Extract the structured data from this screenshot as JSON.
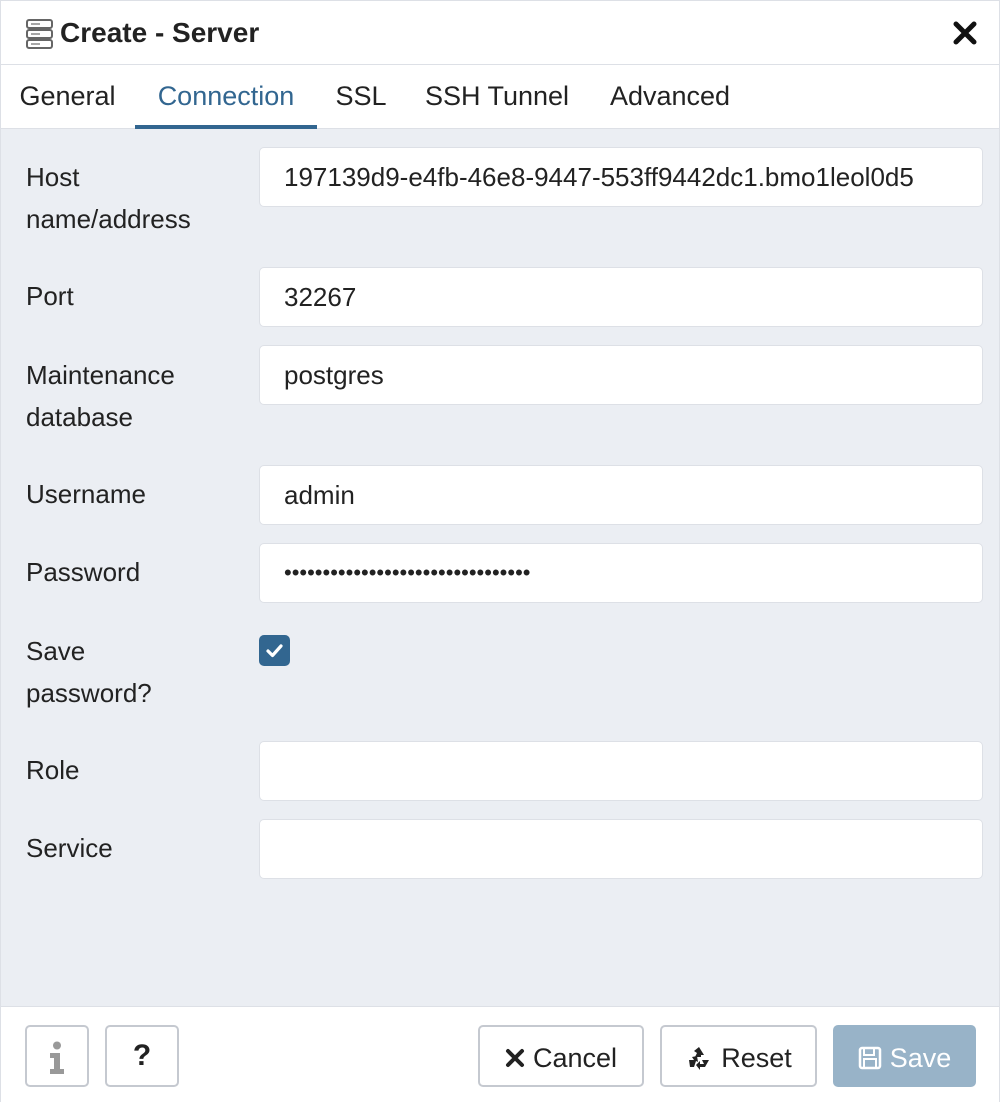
{
  "dialog": {
    "title": "Create - Server"
  },
  "tabs": [
    {
      "label": "General"
    },
    {
      "label": "Connection"
    },
    {
      "label": "SSL"
    },
    {
      "label": "SSH Tunnel"
    },
    {
      "label": "Advanced"
    }
  ],
  "active_tab": "Connection",
  "form": {
    "host": {
      "label_line1": "Host",
      "label_line2": "name/address",
      "value": "197139d9-e4fb-46e8-9447-553ff9442dc1.bmo1leol0d5"
    },
    "port": {
      "label": "Port",
      "value": "32267"
    },
    "maintenance_db": {
      "label_line1": "Maintenance",
      "label_line2": "database",
      "value": "postgres"
    },
    "username": {
      "label": "Username",
      "value": "admin"
    },
    "password": {
      "label": "Password",
      "value": "••••••••••••••••••••••••••••••••"
    },
    "save_password": {
      "label_line1": "Save",
      "label_line2": "password?",
      "checked": true
    },
    "role": {
      "label": "Role",
      "value": ""
    },
    "service": {
      "label": "Service",
      "value": ""
    }
  },
  "footer": {
    "info_icon": "info-icon",
    "help_label": "?",
    "cancel_label": "Cancel",
    "reset_label": "Reset",
    "save_label": "Save"
  },
  "colors": {
    "accent": "#326690",
    "body_bg": "#ebeef3",
    "save_disabled_bg": "#98b3c8"
  }
}
